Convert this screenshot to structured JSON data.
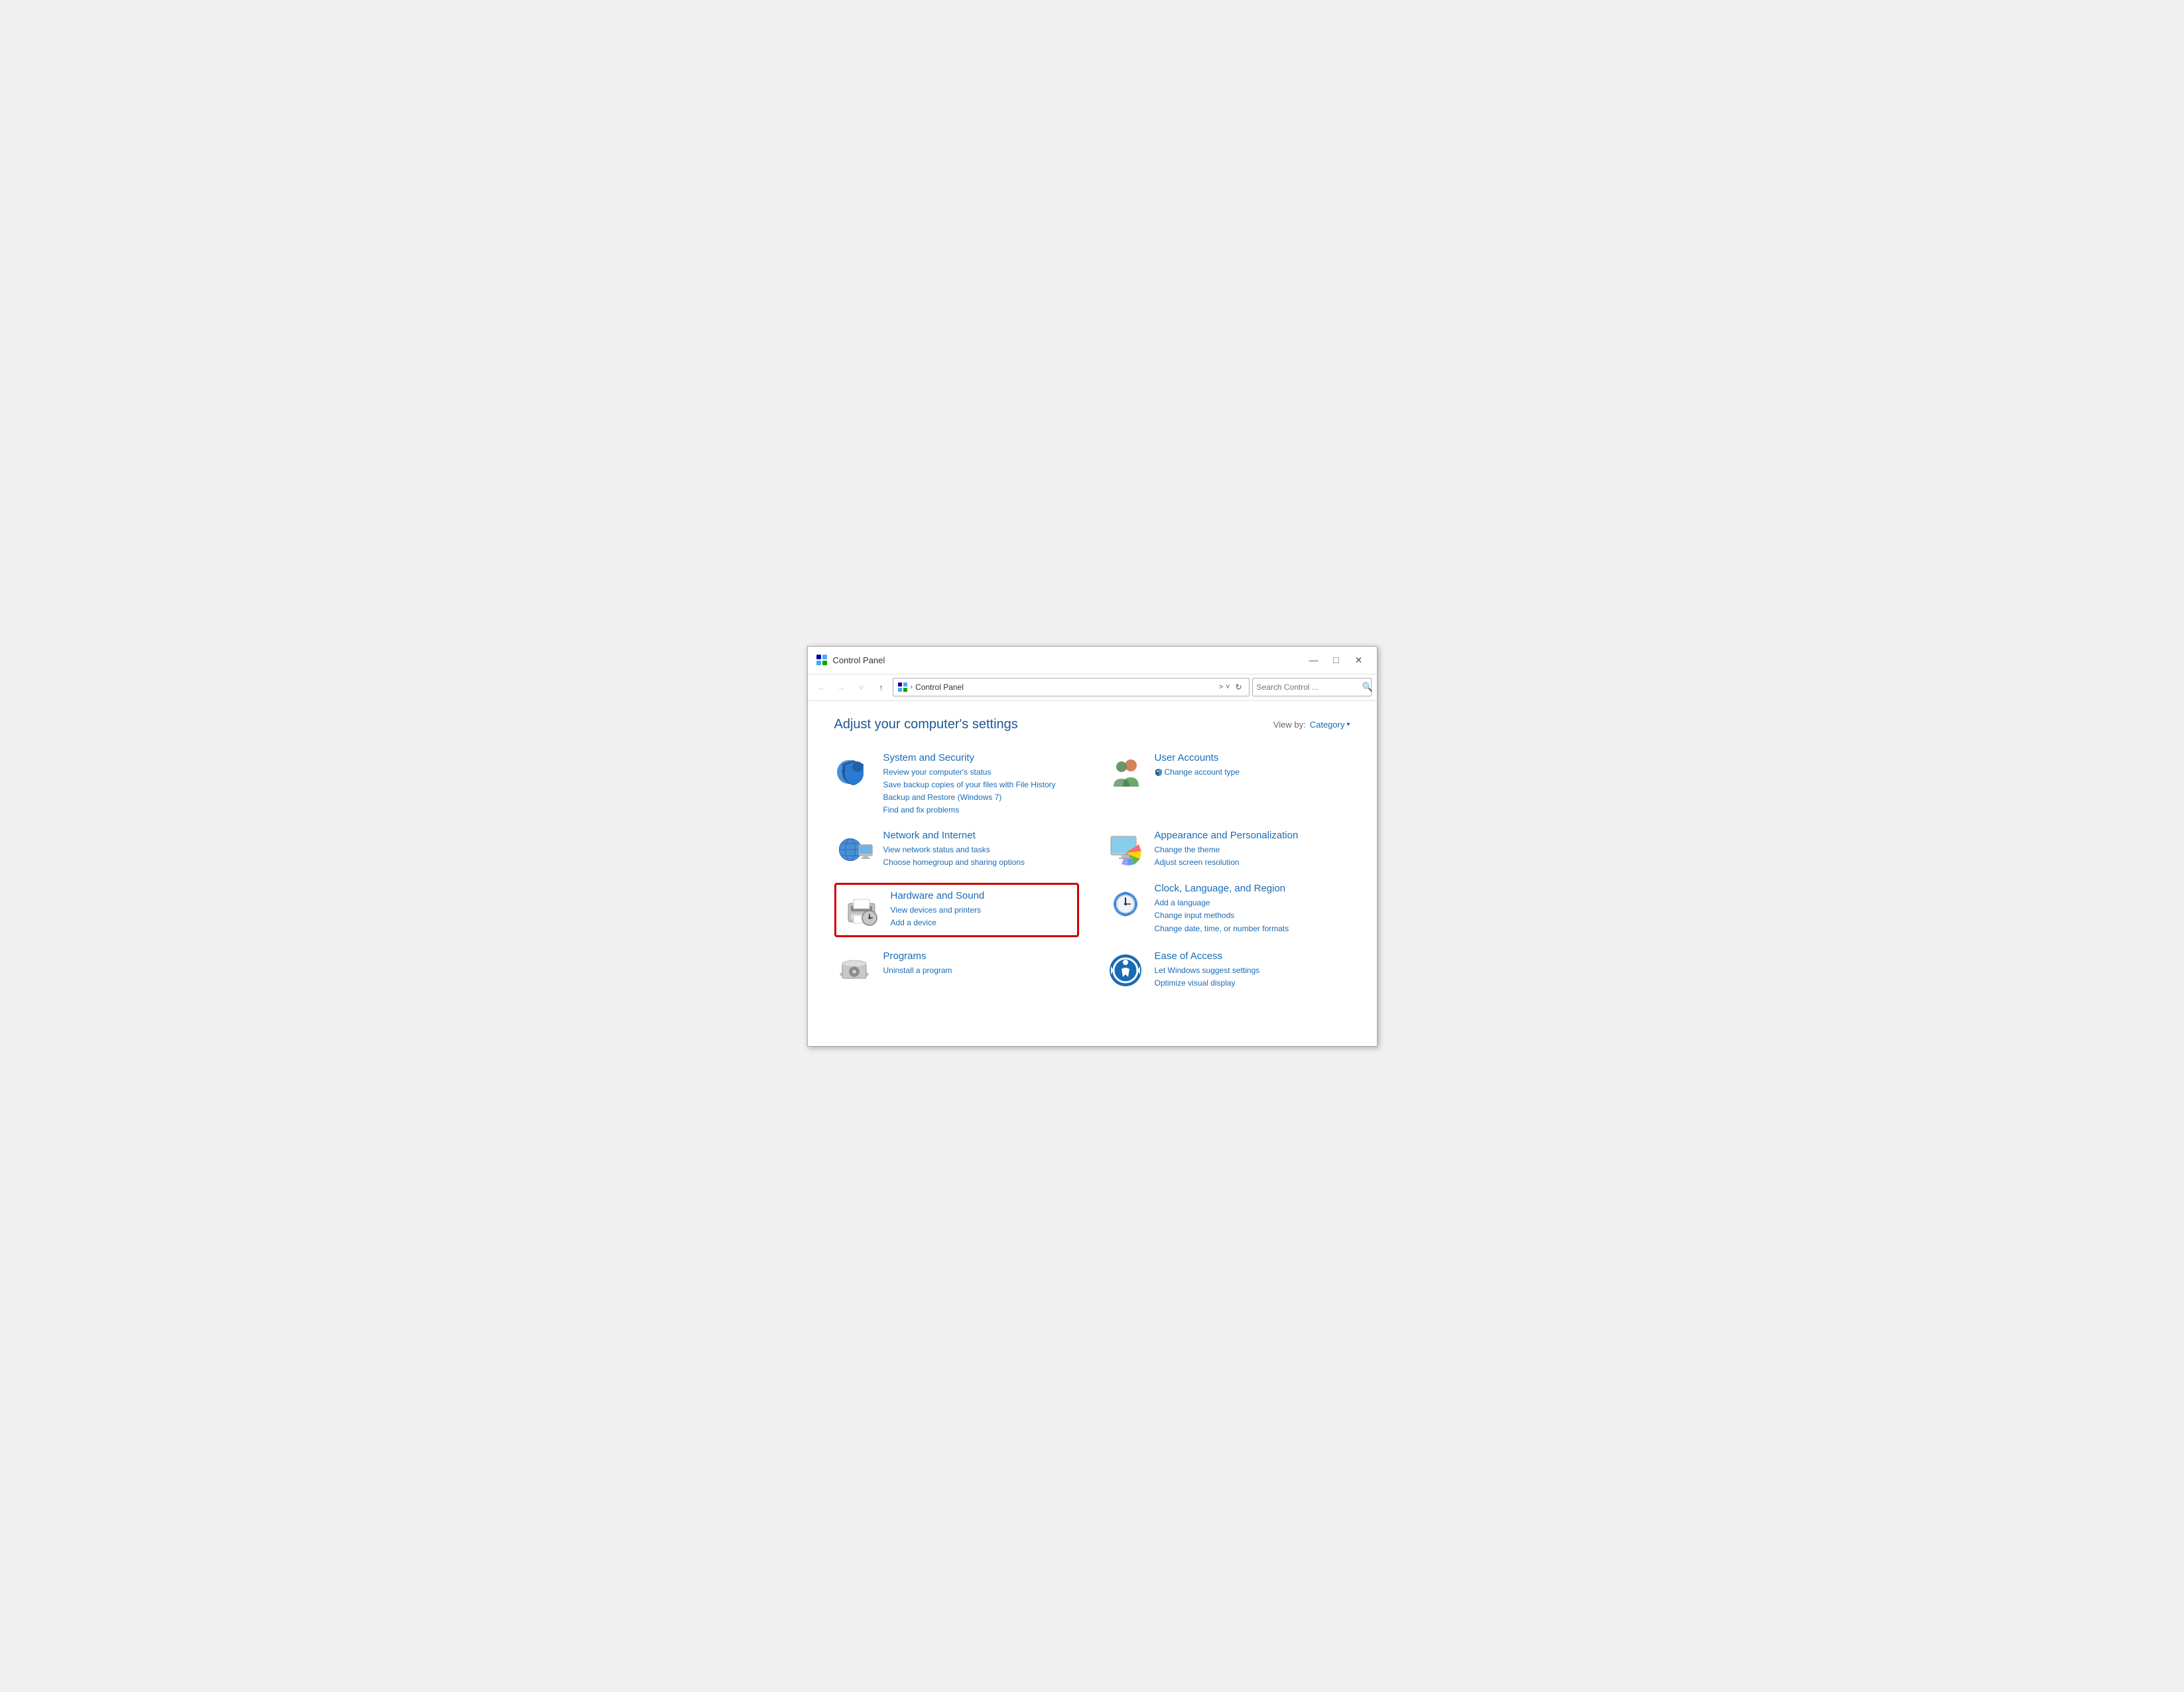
{
  "window": {
    "title": "Control Panel",
    "icon": "control-panel-icon"
  },
  "titlebar": {
    "minimize_label": "—",
    "maximize_label": "□",
    "close_label": "✕"
  },
  "navbar": {
    "back_label": "←",
    "forward_label": "→",
    "dropdown_label": "˅",
    "up_label": "↑",
    "address": "Control Panel",
    "address_chevron": ">",
    "address_dropdown": "˅",
    "refresh_label": "↻",
    "search_placeholder": "Search Control ...",
    "search_icon": "🔍"
  },
  "page": {
    "title": "Adjust your computer's settings",
    "view_by_label": "View by:",
    "view_by_value": "Category",
    "view_by_arrow": "▾"
  },
  "categories": [
    {
      "id": "system-security",
      "name": "System and Security",
      "links": [
        "Review your computer's status",
        "Save backup copies of your files with File History",
        "Backup and Restore (Windows 7)",
        "Find and fix problems"
      ],
      "highlighted": false
    },
    {
      "id": "user-accounts",
      "name": "User Accounts",
      "links": [
        "Change account type"
      ],
      "link_has_shield": [
        true
      ],
      "highlighted": false
    },
    {
      "id": "network-internet",
      "name": "Network and Internet",
      "links": [
        "View network status and tasks",
        "Choose homegroup and sharing options"
      ],
      "highlighted": false
    },
    {
      "id": "appearance-personalization",
      "name": "Appearance and Personalization",
      "links": [
        "Change the theme",
        "Adjust screen resolution"
      ],
      "highlighted": false
    },
    {
      "id": "hardware-sound",
      "name": "Hardware and Sound",
      "links": [
        "View devices and printers",
        "Add a device"
      ],
      "highlighted": true
    },
    {
      "id": "clock-language-region",
      "name": "Clock, Language, and Region",
      "links": [
        "Add a language",
        "Change input methods",
        "Change date, time, or number formats"
      ],
      "highlighted": false
    },
    {
      "id": "programs",
      "name": "Programs",
      "links": [
        "Uninstall a program"
      ],
      "highlighted": false
    },
    {
      "id": "ease-of-access",
      "name": "Ease of Access",
      "links": [
        "Let Windows suggest settings",
        "Optimize visual display"
      ],
      "highlighted": false
    }
  ],
  "colors": {
    "link_blue": "#1a6bb5",
    "highlight_red": "#cc0000",
    "title_blue": "#1e5796"
  }
}
